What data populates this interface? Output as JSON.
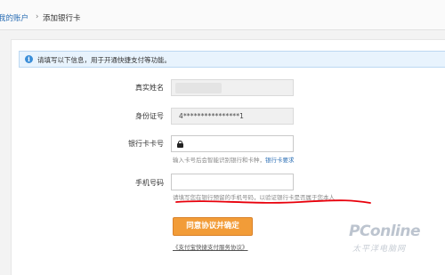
{
  "breadcrumb": {
    "parent": "我的账户",
    "separator": "›",
    "current": "添加银行卡"
  },
  "notice": {
    "icon": "info-icon",
    "icon_glyph": "i",
    "text": "请填写以下信息，用于开通快捷支付等功能。"
  },
  "form": {
    "name": {
      "label": "真实姓名"
    },
    "id_number": {
      "label": "身份证号",
      "value": "4****************1"
    },
    "card_number": {
      "label": "银行卡卡号",
      "value": "",
      "hint": "输入卡号后会智能识别银行和卡种，",
      "hint_link": "银行卡要求"
    },
    "phone": {
      "label": "手机号码",
      "value": "",
      "hint": "请填写您在银行预留的手机号码，以验证银行卡是否属于您本人"
    },
    "submit_label": "同意协议并确定",
    "agreement_link": "《支付宝快捷支付服务协议》"
  },
  "colors": {
    "accent": "#f29c38",
    "link": "#2c6fb5",
    "annotation": "#e8000b"
  },
  "watermark": {
    "logo": "PConline",
    "sub": "太平洋电脑网"
  }
}
